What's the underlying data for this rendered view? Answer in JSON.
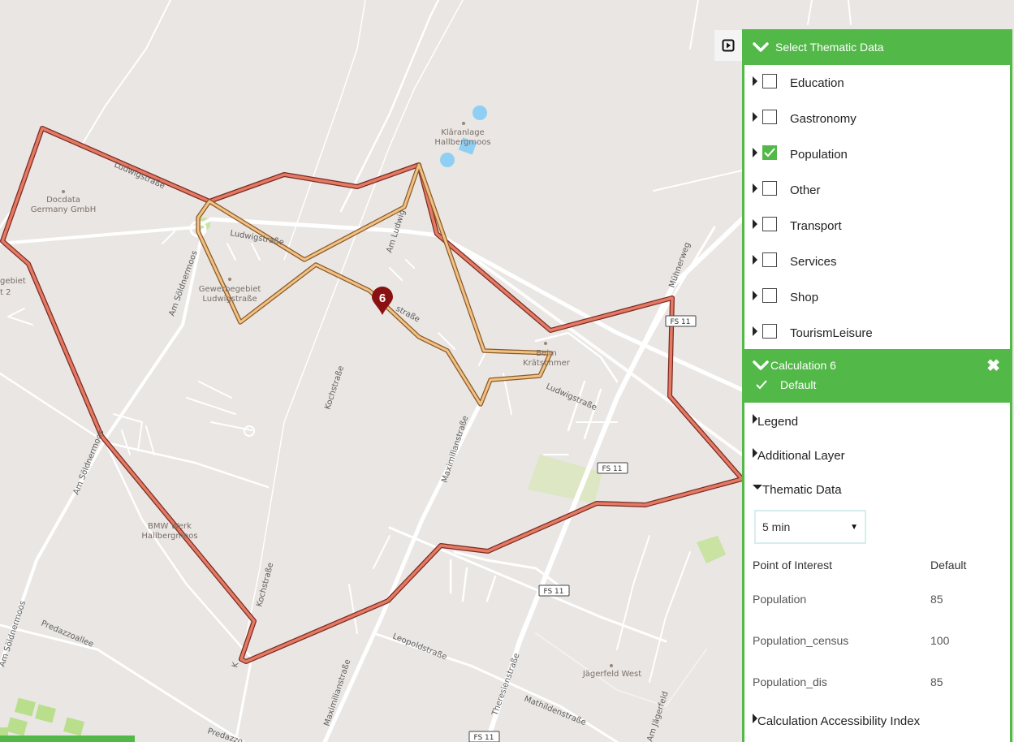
{
  "map": {
    "labels": {
      "klaeranlage": [
        "Kläranlage",
        "Hallbergmoos"
      ],
      "docdata": [
        "Docdata",
        "Germany GmbH"
      ],
      "gewerbe": [
        "Gewerbegebiet",
        "Ludwigstraße"
      ],
      "gewerbe_left": [
        "gebiet",
        "t 2"
      ],
      "bmw": [
        "BMW Werk",
        "Hallbergmoos"
      ],
      "kraetschmer": [
        "Beim",
        "Krätschmer"
      ],
      "jaegerfeld": "Jägerfeld West"
    },
    "streets": {
      "ludwigstrasse_1": "Ludwigstraße",
      "ludwigstrasse_2": "Ludwigstraße",
      "ludwigstrasse_top": "Ludwigstraße",
      "am_ludwig": "Am Ludwig",
      "strasse_marker": "straße",
      "am_soeldnermoos_1": "Am Söldnermoos",
      "am_soeldnermoos_2": "Am Söldnermoos",
      "am_soeldnermoos_3": "Am Söldnermoos",
      "kochstrasse_1": "Kochstraße",
      "kochstrasse_2": "Kochstraße",
      "maximilianstrasse_1": "Maximilianstraße",
      "maximilianstrasse_2": "Maximilianstraße",
      "predazzoallee_1": "Predazzoallee",
      "predazzoallee_2": "Predazzo",
      "leopoldstrasse": "Leopoldstraße",
      "theresienstrasse": "Theresienstraße",
      "mathildenstrasse": "Mathildenstraße",
      "am_jaegerfeld": "Am Jägerfeld",
      "muehnerweg": "Mühnerweg",
      "k_label": "K"
    },
    "shields": [
      "FS 11",
      "FS 11",
      "FS 11",
      "FS 11"
    ],
    "marker_number": "6",
    "colors": {
      "outer_isochrone": "#e57a64",
      "inner_isochrone": "#f2c184",
      "marker": "#8a1111",
      "water": "#8fcff3",
      "green_area": "#dde7c3",
      "road": "#ffffff",
      "background": "#e9e6e3"
    }
  },
  "panel": {
    "thematic_header": "Select Thematic Data",
    "categories": [
      {
        "label": "Education",
        "checked": false
      },
      {
        "label": "Gastronomy",
        "checked": false
      },
      {
        "label": "Population",
        "checked": true
      },
      {
        "label": "Other",
        "checked": false
      },
      {
        "label": "Transport",
        "checked": false
      },
      {
        "label": "Services",
        "checked": false
      },
      {
        "label": "Shop",
        "checked": false
      },
      {
        "label": "TourismLeisure",
        "checked": false
      }
    ],
    "calculation": {
      "title": "Calculation 6",
      "subtitle": "Default"
    },
    "sections": {
      "legend": "Legend",
      "additional_layer": "Additional Layer",
      "thematic_data": "Thematic Data",
      "accessibility_index": "Calculation Accessibility Index"
    },
    "time_select": {
      "selected": "5 min"
    },
    "table": {
      "headers": [
        "Point of Interest",
        "Default"
      ],
      "rows": [
        {
          "poi": "Population",
          "value": "85"
        },
        {
          "poi": "Population_census",
          "value": "100"
        },
        {
          "poi": "Population_dis",
          "value": "85"
        }
      ]
    },
    "accent_color": "#52b848"
  }
}
